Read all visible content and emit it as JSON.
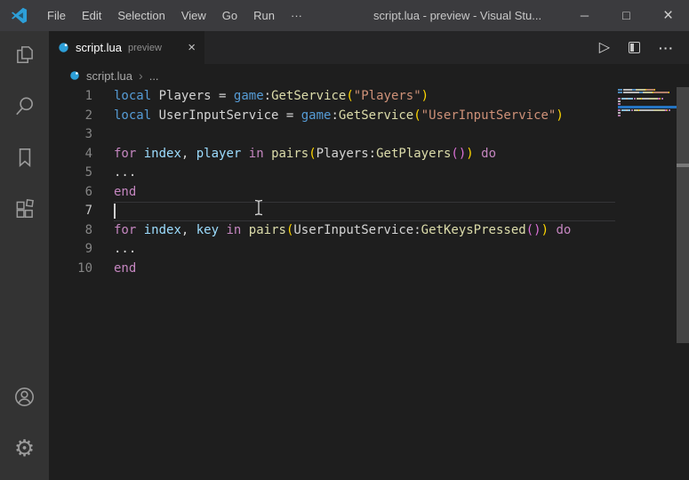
{
  "window": {
    "title": "script.lua - preview - Visual Stu...",
    "controls": {
      "minimize": "─",
      "maximize": "□",
      "close": "×"
    }
  },
  "menus": [
    "File",
    "Edit",
    "Selection",
    "View",
    "Go",
    "Run",
    "···"
  ],
  "activity_bar": {
    "top": [
      {
        "name": "explorer"
      },
      {
        "name": "search"
      },
      {
        "name": "bookmarks"
      },
      {
        "name": "extensions"
      }
    ],
    "bottom": [
      {
        "name": "account"
      },
      {
        "name": "settings"
      }
    ],
    "settings_glyph": "⚙"
  },
  "tab": {
    "file": "script.lua",
    "badge": "preview",
    "close_glyph": "×"
  },
  "editor_actions": {
    "run_glyph": "▷",
    "more_glyph": "···"
  },
  "breadcrumb": {
    "file": "script.lua",
    "separator": "›",
    "rest": "..."
  },
  "editor": {
    "cursor_line": 7,
    "line_height": 21.5,
    "lines": [
      {
        "num": 1,
        "tokens": [
          [
            "local",
            "kw"
          ],
          [
            " ",
            "pl"
          ],
          [
            "Players",
            "var"
          ],
          [
            " = ",
            "pl"
          ],
          [
            "game",
            "kw"
          ],
          [
            ":",
            "pl"
          ],
          [
            "GetService",
            "fn"
          ],
          [
            "(",
            "b1"
          ],
          [
            "\"Players\"",
            "str"
          ],
          [
            ")",
            "b1"
          ]
        ]
      },
      {
        "num": 2,
        "tokens": [
          [
            "local",
            "kw"
          ],
          [
            " ",
            "pl"
          ],
          [
            "UserInputService",
            "var"
          ],
          [
            " = ",
            "pl"
          ],
          [
            "game",
            "kw"
          ],
          [
            ":",
            "pl"
          ],
          [
            "GetService",
            "fn"
          ],
          [
            "(",
            "b1"
          ],
          [
            "\"UserInputService\"",
            "str"
          ],
          [
            ")",
            "b1"
          ]
        ]
      },
      {
        "num": 3,
        "tokens": []
      },
      {
        "num": 4,
        "tokens": [
          [
            "for",
            "ctrl"
          ],
          [
            " ",
            "pl"
          ],
          [
            "index",
            "param"
          ],
          [
            ", ",
            "pl"
          ],
          [
            "player",
            "param"
          ],
          [
            " ",
            "pl"
          ],
          [
            "in",
            "ctrl"
          ],
          [
            " ",
            "pl"
          ],
          [
            "pairs",
            "fn"
          ],
          [
            "(",
            "b1"
          ],
          [
            "Players",
            "var"
          ],
          [
            ":",
            "pl"
          ],
          [
            "GetPlayers",
            "fn"
          ],
          [
            "(",
            "b2"
          ],
          [
            ")",
            "b2"
          ],
          [
            ")",
            "b1"
          ],
          [
            " ",
            "pl"
          ],
          [
            "do",
            "ctrl"
          ]
        ]
      },
      {
        "num": 5,
        "tokens": [
          [
            "...",
            "pl"
          ]
        ]
      },
      {
        "num": 6,
        "tokens": [
          [
            "end",
            "ctrl"
          ]
        ]
      },
      {
        "num": 7,
        "tokens": []
      },
      {
        "num": 8,
        "tokens": [
          [
            "for",
            "ctrl"
          ],
          [
            " ",
            "pl"
          ],
          [
            "index",
            "param"
          ],
          [
            ", ",
            "pl"
          ],
          [
            "key",
            "param"
          ],
          [
            " ",
            "pl"
          ],
          [
            "in",
            "ctrl"
          ],
          [
            " ",
            "pl"
          ],
          [
            "pairs",
            "fn"
          ],
          [
            "(",
            "b1"
          ],
          [
            "UserInputService",
            "var"
          ],
          [
            ":",
            "pl"
          ],
          [
            "GetKeysPressed",
            "fn"
          ],
          [
            "(",
            "b2"
          ],
          [
            ")",
            "b2"
          ],
          [
            ")",
            "b1"
          ],
          [
            " ",
            "pl"
          ],
          [
            "do",
            "ctrl"
          ]
        ]
      },
      {
        "num": 9,
        "tokens": [
          [
            "...",
            "pl"
          ]
        ]
      },
      {
        "num": 10,
        "tokens": [
          [
            "end",
            "ctrl"
          ]
        ]
      }
    ]
  },
  "colors": {
    "tokens": {
      "kw": "#569cd6",
      "ctrl": "#c586c0",
      "var": "#d4d4d4",
      "param": "#9cdcfe",
      "fn": "#dcdcaa",
      "str": "#ce9178",
      "b1": "#ffd700",
      "b2": "#da70d6",
      "pl": "#d4d4d4"
    },
    "minimap_cursor_line": "#2474c2",
    "accent_blue": "#2d9fd8",
    "editor_bg": "#1e1e1e",
    "titlebar_bg": "#3b3b3e",
    "activitybar_bg": "#333333",
    "tabstrip_bg": "#252526"
  }
}
